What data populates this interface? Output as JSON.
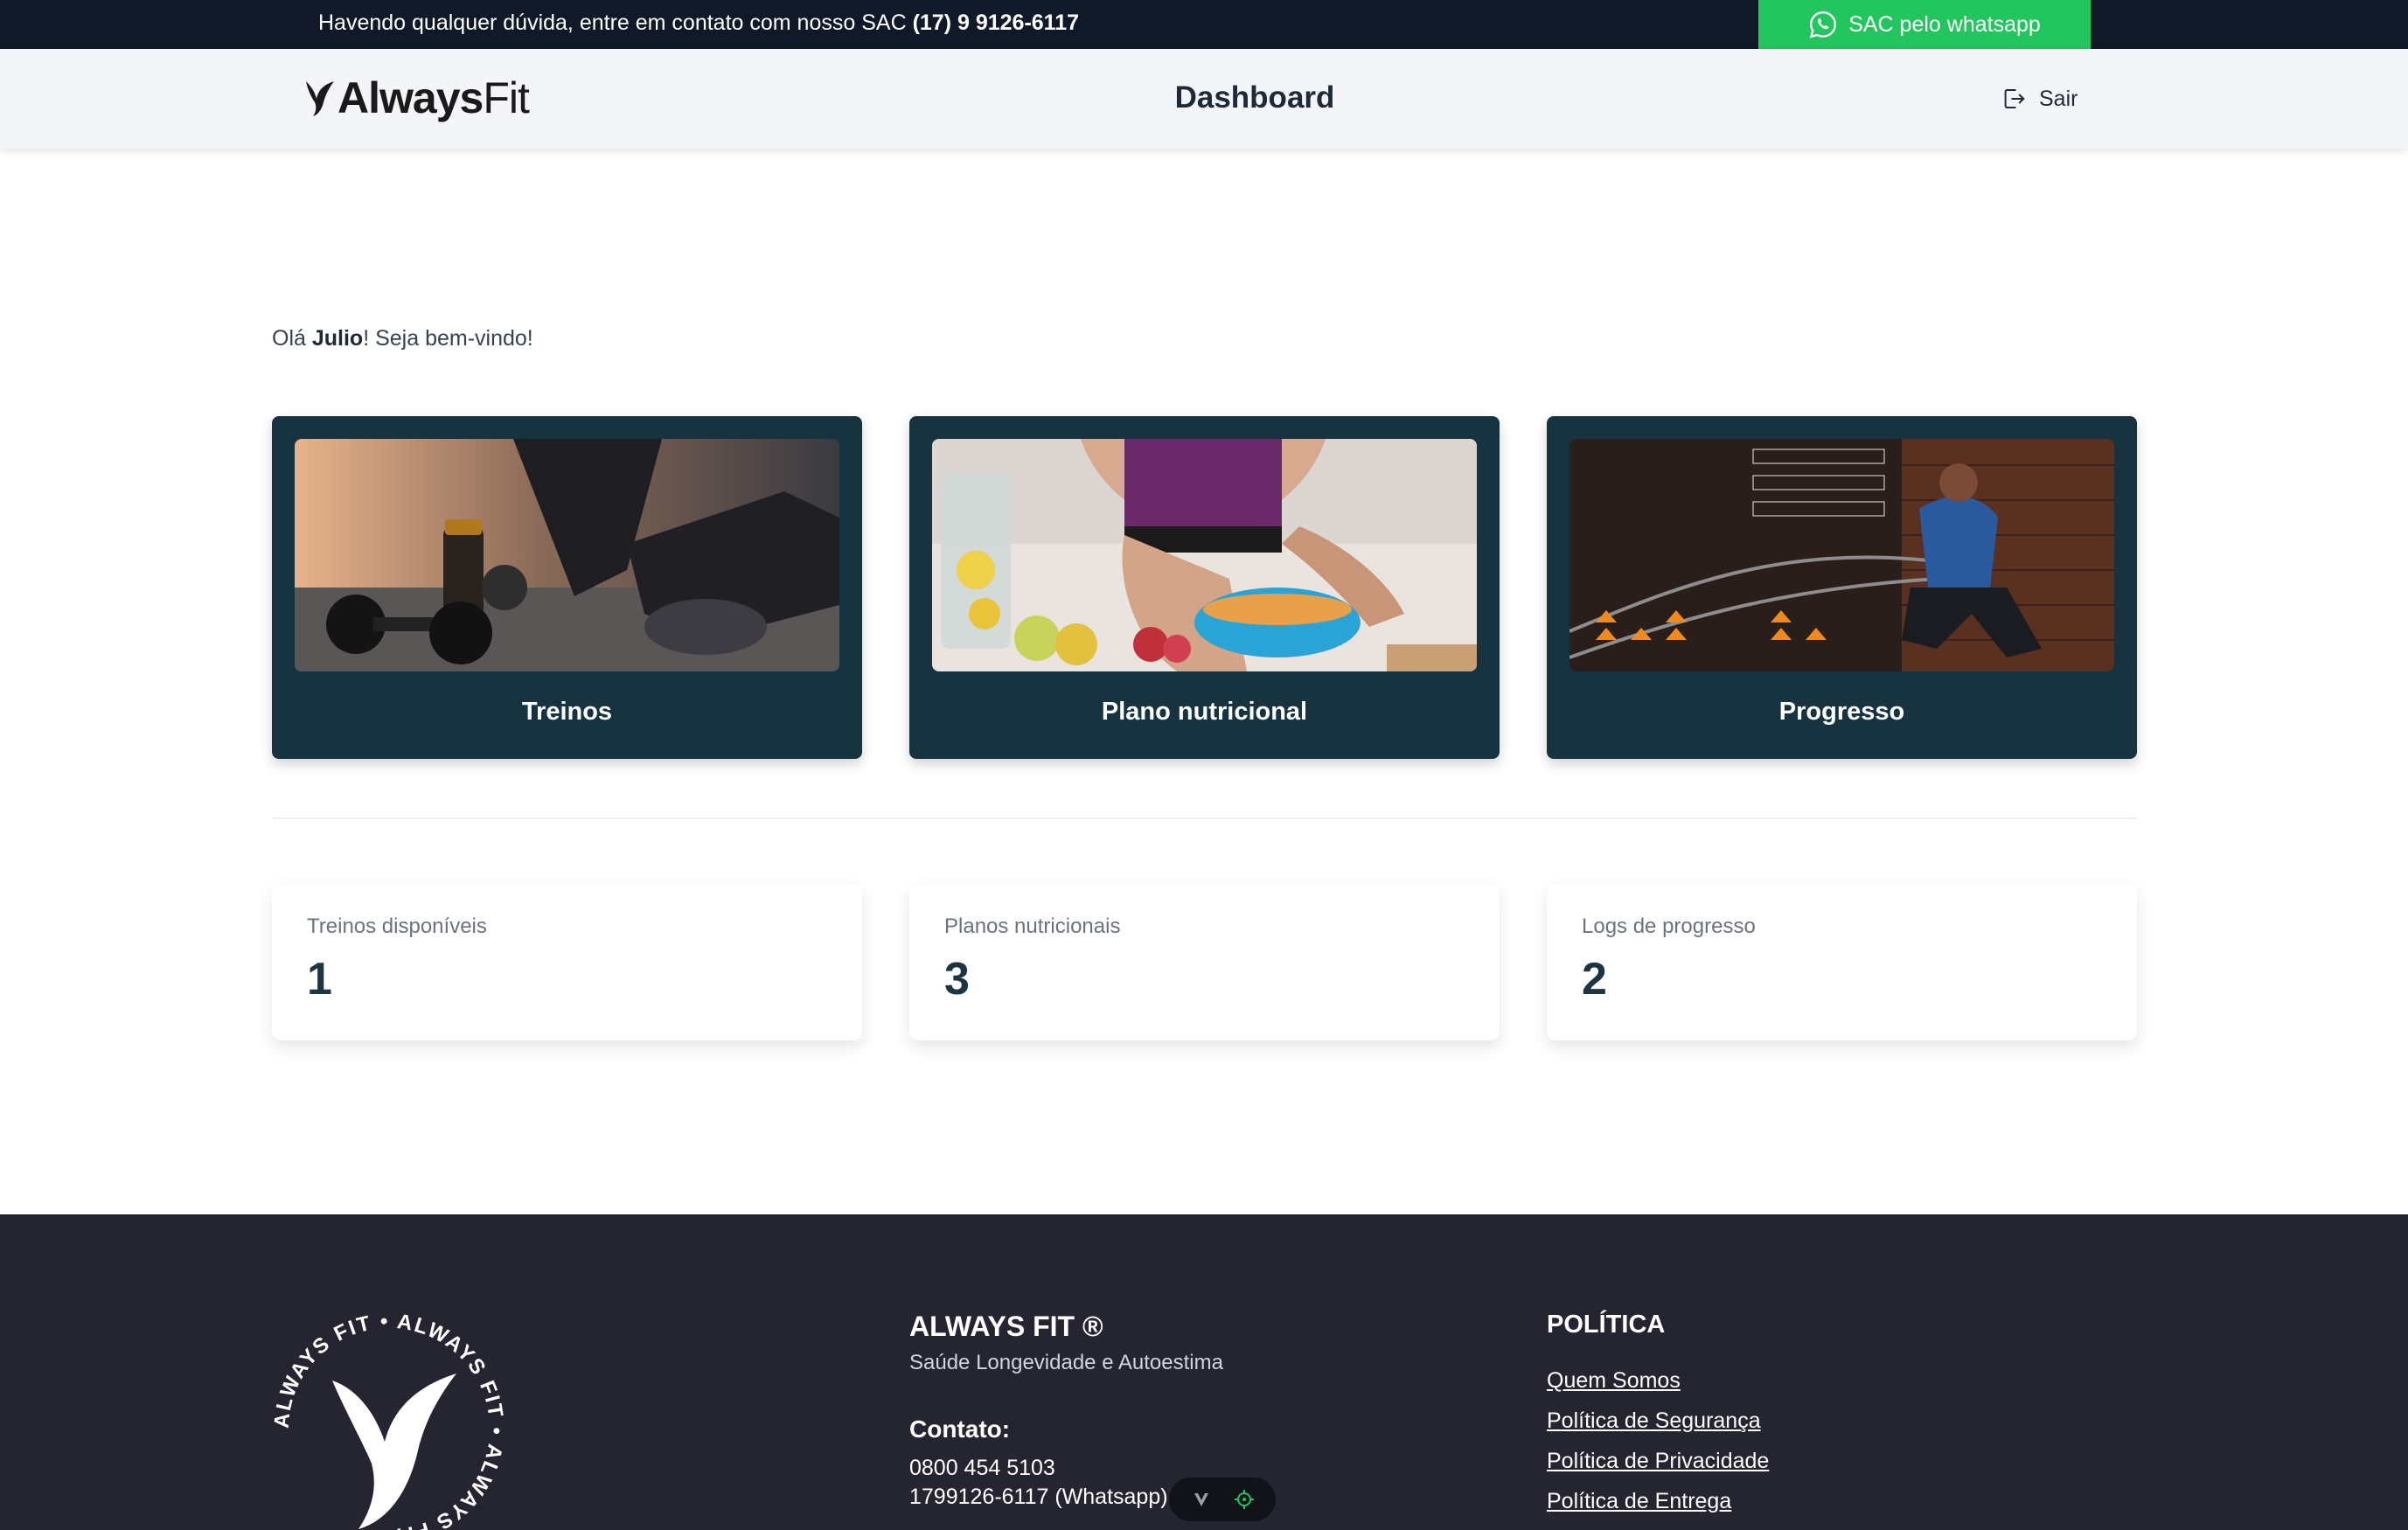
{
  "topbar": {
    "sac_text": "Havendo qualquer dúvida, entre em contato com nosso SAC",
    "sac_phone": "(17) 9 9126-6117",
    "whatsapp_button": "SAC pelo whatsapp",
    "whatsapp_color": "#22c55e"
  },
  "header": {
    "logo_bold": "Always",
    "logo_light": "Fit",
    "title": "Dashboard",
    "logout_label": "Sair"
  },
  "greeting": {
    "prefix": "Olá ",
    "name": "Julio",
    "suffix": "! Seja bem-vindo!"
  },
  "cards": [
    {
      "label": "Treinos",
      "image": "workout-photo"
    },
    {
      "label": "Plano nutricional",
      "image": "nutrition-photo"
    },
    {
      "label": "Progresso",
      "image": "progress-photo"
    }
  ],
  "stats": [
    {
      "label": "Treinos disponíveis",
      "value": "1"
    },
    {
      "label": "Planos nutricionais",
      "value": "3"
    },
    {
      "label": "Logs de progresso",
      "value": "2"
    }
  ],
  "footer": {
    "badge_text": "ALWAYS FIT • ALWAYS FIT • ALWAYS FIT •",
    "brand_name": "ALWAYS FIT ®",
    "brand_tagline": "Saúde Longevidade e Autoestima",
    "contact_title": "Contato:",
    "phone": "0800 454 5103",
    "whatsapp": "1799126-6117 (Whatsapp)",
    "policy_title": "POLÍTICA",
    "policy_links": [
      "Quem Somos",
      "Política de Segurança",
      "Política de Privacidade",
      "Política de Entrega"
    ]
  },
  "colors": {
    "topbar_bg": "#111827",
    "card_bg": "#183340",
    "footer_bg": "#252532"
  }
}
